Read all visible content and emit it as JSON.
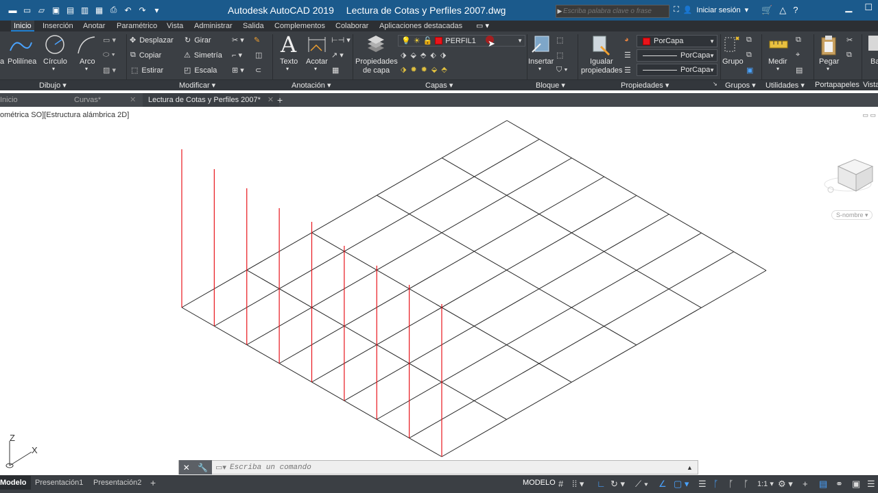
{
  "titlebar": {
    "app_name": "Autodesk AutoCAD 2019",
    "file_name": "Lectura de Cotas y Perfiles 2007.dwg",
    "search_placeholder": "Escriba palabra clave o frase",
    "signin_label": "Iniciar sesión"
  },
  "ribbon_tabs": [
    "Inicio",
    "Inserción",
    "Anotar",
    "Paramétrico",
    "Vista",
    "Administrar",
    "Salida",
    "Complementos",
    "Colaborar",
    "Aplicaciones destacadas"
  ],
  "ribbon": {
    "dibujo": {
      "linea_partial": "a",
      "polilinea": "Polilínea",
      "circulo": "Círculo",
      "arco": "Arco"
    },
    "modificar": {
      "desplazar": "Desplazar",
      "girar": "Girar",
      "copiar": "Copiar",
      "simetria": "Simetría",
      "estirar": "Estirar",
      "escala": "Escala"
    },
    "anotacion": {
      "texto": "Texto",
      "acotar": "Acotar"
    },
    "capas": {
      "propiedades_line1": "Propiedades",
      "propiedades_line2": "de capa",
      "current_layer": "PERFIL1"
    },
    "bloque": {
      "insertar": "Insertar"
    },
    "propiedades": {
      "igualar_line1": "Igualar",
      "igualar_line2": "propiedades",
      "color": "PorCapa",
      "linetype": "PorCapa",
      "lineweight": "PorCapa"
    },
    "grupos": {
      "grupo": "Grupo"
    },
    "utilidades": {
      "medir": "Medir"
    },
    "portapapeles": {
      "pegar": "Pegar"
    },
    "vista_partial": "Ba"
  },
  "panels": {
    "dibujo": "Dibujo",
    "modificar": "Modificar",
    "anotacion": "Anotación",
    "capas": "Capas",
    "bloque": "Bloque",
    "propiedades": "Propiedades",
    "grupos": "Grupos",
    "utilidades": "Utilidades",
    "portapapeles": "Portapapeles",
    "vista": "Vista"
  },
  "doc_tabs": [
    {
      "label": "Inicio"
    },
    {
      "label": "Curvas*"
    },
    {
      "label": "Lectura de Cotas y Perfiles 2007*"
    }
  ],
  "viewport": {
    "label": "ométrica SO][Estructura alámbrica 2D]",
    "ucs_z": "Z",
    "ucs_x": "X",
    "navigation_label": "S-nombre"
  },
  "command_line": {
    "placeholder": "Escriba un comando"
  },
  "layout_tabs": [
    "Modelo",
    "Presentación1",
    "Presentación2"
  ],
  "status": {
    "space": "MODELO",
    "scale": "1:1"
  },
  "colors": {
    "accent": "#1f7fd1",
    "titlebar": "#1b5a8c",
    "ribbon": "#3b3f44",
    "profile_lines": "#e8141b"
  }
}
